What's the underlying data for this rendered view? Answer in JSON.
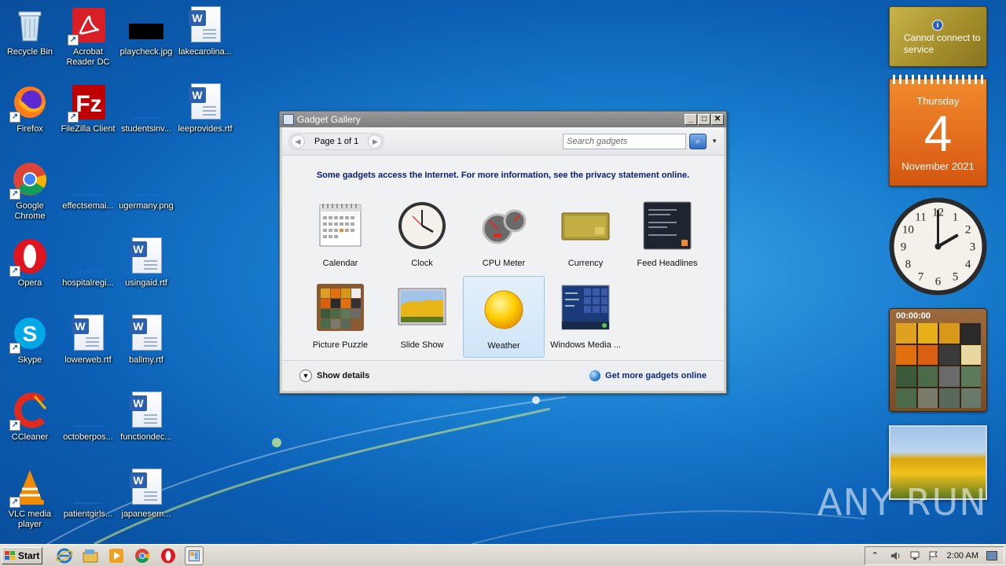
{
  "desktop": {
    "icons": [
      {
        "label": "Recycle Bin"
      },
      {
        "label": "Acrobat Reader DC"
      },
      {
        "label": "playcheck.jpg"
      },
      {
        "label": "lakecarolina..."
      },
      {
        "label": "Firefox"
      },
      {
        "label": "FileZilla Client"
      },
      {
        "label": "studentsinv..."
      },
      {
        "label": "leeprovides.rtf"
      },
      {
        "label": "Google Chrome"
      },
      {
        "label": "effectsemai..."
      },
      {
        "label": "ugermany.png"
      },
      {
        "label": "Opera"
      },
      {
        "label": "hospitalregi..."
      },
      {
        "label": "usingaid.rtf"
      },
      {
        "label": "Skype"
      },
      {
        "label": "lowerweb.rtf"
      },
      {
        "label": "ballmy.rtf"
      },
      {
        "label": "CCleaner"
      },
      {
        "label": "octoberpos..."
      },
      {
        "label": "functiondec..."
      },
      {
        "label": "VLC media player"
      },
      {
        "label": "patientgirls..."
      },
      {
        "label": "japanesem..."
      }
    ]
  },
  "sidebar": {
    "currency": {
      "message": "Cannot connect to service",
      "info_glyph": "i"
    },
    "calendar": {
      "weekday": "Thursday",
      "day": "4",
      "month_year": "November 2021"
    },
    "clock": {
      "hour": 2,
      "minute": 0
    },
    "puzzle": {
      "timer": "00:00:00"
    }
  },
  "gallery": {
    "title": "Gadget Gallery",
    "page_label": "Page 1 of 1",
    "search_placeholder": "Search gadgets",
    "notice": "Some gadgets access the Internet.  For more information, see the privacy statement online.",
    "gadgets": [
      {
        "label": "Calendar"
      },
      {
        "label": "Clock"
      },
      {
        "label": "CPU Meter"
      },
      {
        "label": "Currency"
      },
      {
        "label": "Feed Headlines"
      },
      {
        "label": "Picture Puzzle"
      },
      {
        "label": "Slide Show"
      },
      {
        "label": "Weather",
        "selected": true
      },
      {
        "label": "Windows Media ..."
      }
    ],
    "show_details": "Show details",
    "get_more": "Get more gadgets online"
  },
  "taskbar": {
    "start_label": "Start",
    "clock": "2:00 AM"
  },
  "watermark": "ANY RUN"
}
